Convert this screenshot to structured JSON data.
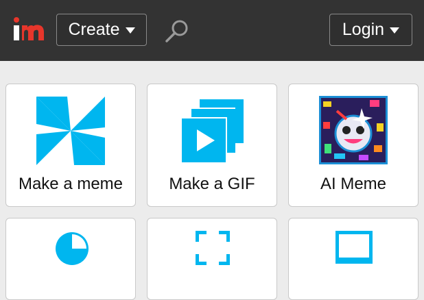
{
  "colors": {
    "header_bg": "#333333",
    "page_bg": "#ececec",
    "accent": "#00b6ef",
    "logo_red": "#e7362b"
  },
  "header": {
    "logo_text": "im",
    "create_label": "Create",
    "login_label": "Login",
    "search_icon": "search-icon",
    "caret_icon": "chevron-down-icon"
  },
  "tiles": [
    {
      "label": "Make a meme",
      "icon": "pinwheel-icon"
    },
    {
      "label": "Make a GIF",
      "icon": "gif-stack-icon"
    },
    {
      "label": "AI Meme",
      "icon": "ai-robot-image"
    },
    {
      "label": "",
      "icon": "pie-chart-icon"
    },
    {
      "label": "",
      "icon": "crop-frame-icon"
    },
    {
      "label": "",
      "icon": "monitor-icon"
    }
  ]
}
